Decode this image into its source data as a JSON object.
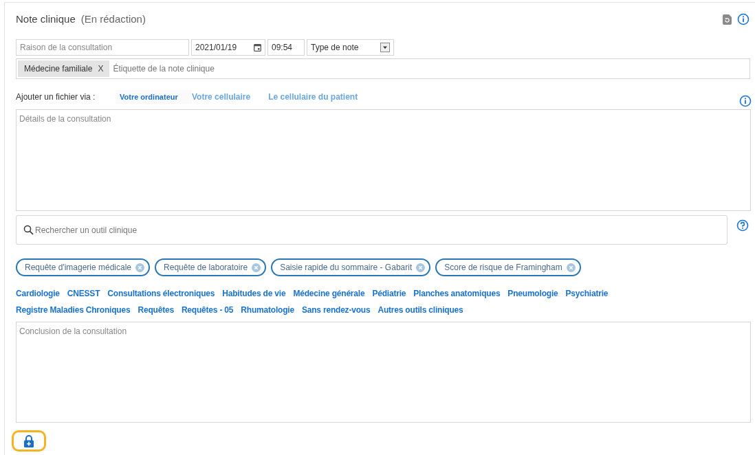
{
  "header": {
    "title": "Note clinique",
    "status": "(En rédaction)"
  },
  "reason": {
    "placeholder": "Raison de la consultation"
  },
  "date": {
    "value": "2021/01/19"
  },
  "time": {
    "value": "09:54"
  },
  "note_type": {
    "value": "Type de note"
  },
  "tags": [
    {
      "label": "Médecine familiale",
      "remove": "X"
    }
  ],
  "tag_input": {
    "placeholder": "Étiquette de la note clinique"
  },
  "upload": {
    "label": "Ajouter un fichier via :",
    "options": [
      {
        "label": "Votre ordinateur",
        "selected": true
      },
      {
        "label": "Votre cellulaire",
        "selected": false
      },
      {
        "label": "Le cellulaire du patient",
        "selected": false
      }
    ]
  },
  "details": {
    "placeholder": "Détails de la consultation"
  },
  "tool_search": {
    "placeholder": "Rechercher un outil clinique"
  },
  "selected_tools": [
    "Requête d'imagerie médicale",
    "Requête de laboratoire",
    "Saisie rapide du sommaire - Gabarit",
    "Score de risque de Framingham"
  ],
  "categories": [
    [
      "Cardiologie",
      "CNESST",
      "Consultations électroniques",
      "Habitudes de vie",
      "Médecine générale",
      "Pédiatrie",
      "Planches anatomiques",
      "Pneumologie",
      "Psychiatrie"
    ],
    [
      "Registre Maladies Chroniques",
      "Requêtes",
      "Requêtes - 05",
      "Rhumatologie",
      "Sans rendez-vous",
      "Autres outils cliniques"
    ]
  ],
  "conclusion": {
    "placeholder": "Conclusion de la consultation"
  }
}
